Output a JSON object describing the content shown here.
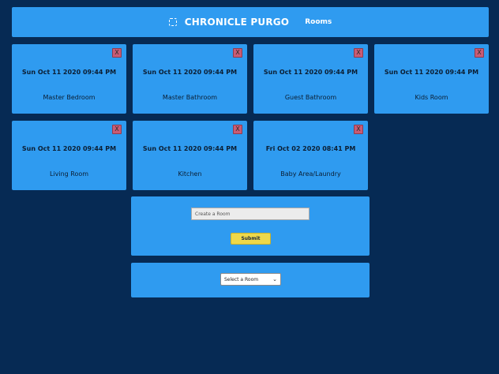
{
  "navbar": {
    "brand": "CHRONICLE PURGO",
    "link": "Rooms"
  },
  "rooms": [
    {
      "date": "Sun Oct 11 2020 09:44 PM",
      "name": "Master Bedroom",
      "delete": "X"
    },
    {
      "date": "Sun Oct 11 2020 09:44 PM",
      "name": "Master Bathroom",
      "delete": "X"
    },
    {
      "date": "Sun Oct 11 2020 09:44 PM",
      "name": "Guest Bathroom",
      "delete": "X"
    },
    {
      "date": "Sun Oct 11 2020 09:44 PM",
      "name": "Kids Room",
      "delete": "X"
    },
    {
      "date": "Sun Oct 11 2020 09:44 PM",
      "name": "Living Room",
      "delete": "X"
    },
    {
      "date": "Sun Oct 11 2020 09:44 PM",
      "name": "Kitchen",
      "delete": "X"
    },
    {
      "date": "Fri Oct 02 2020 08:41 PM",
      "name": "Baby Area/Laundry",
      "delete": "X"
    }
  ],
  "create_form": {
    "placeholder": "Create a Room",
    "submit_label": "Submit"
  },
  "room_select": {
    "selected": "Select a Room"
  }
}
